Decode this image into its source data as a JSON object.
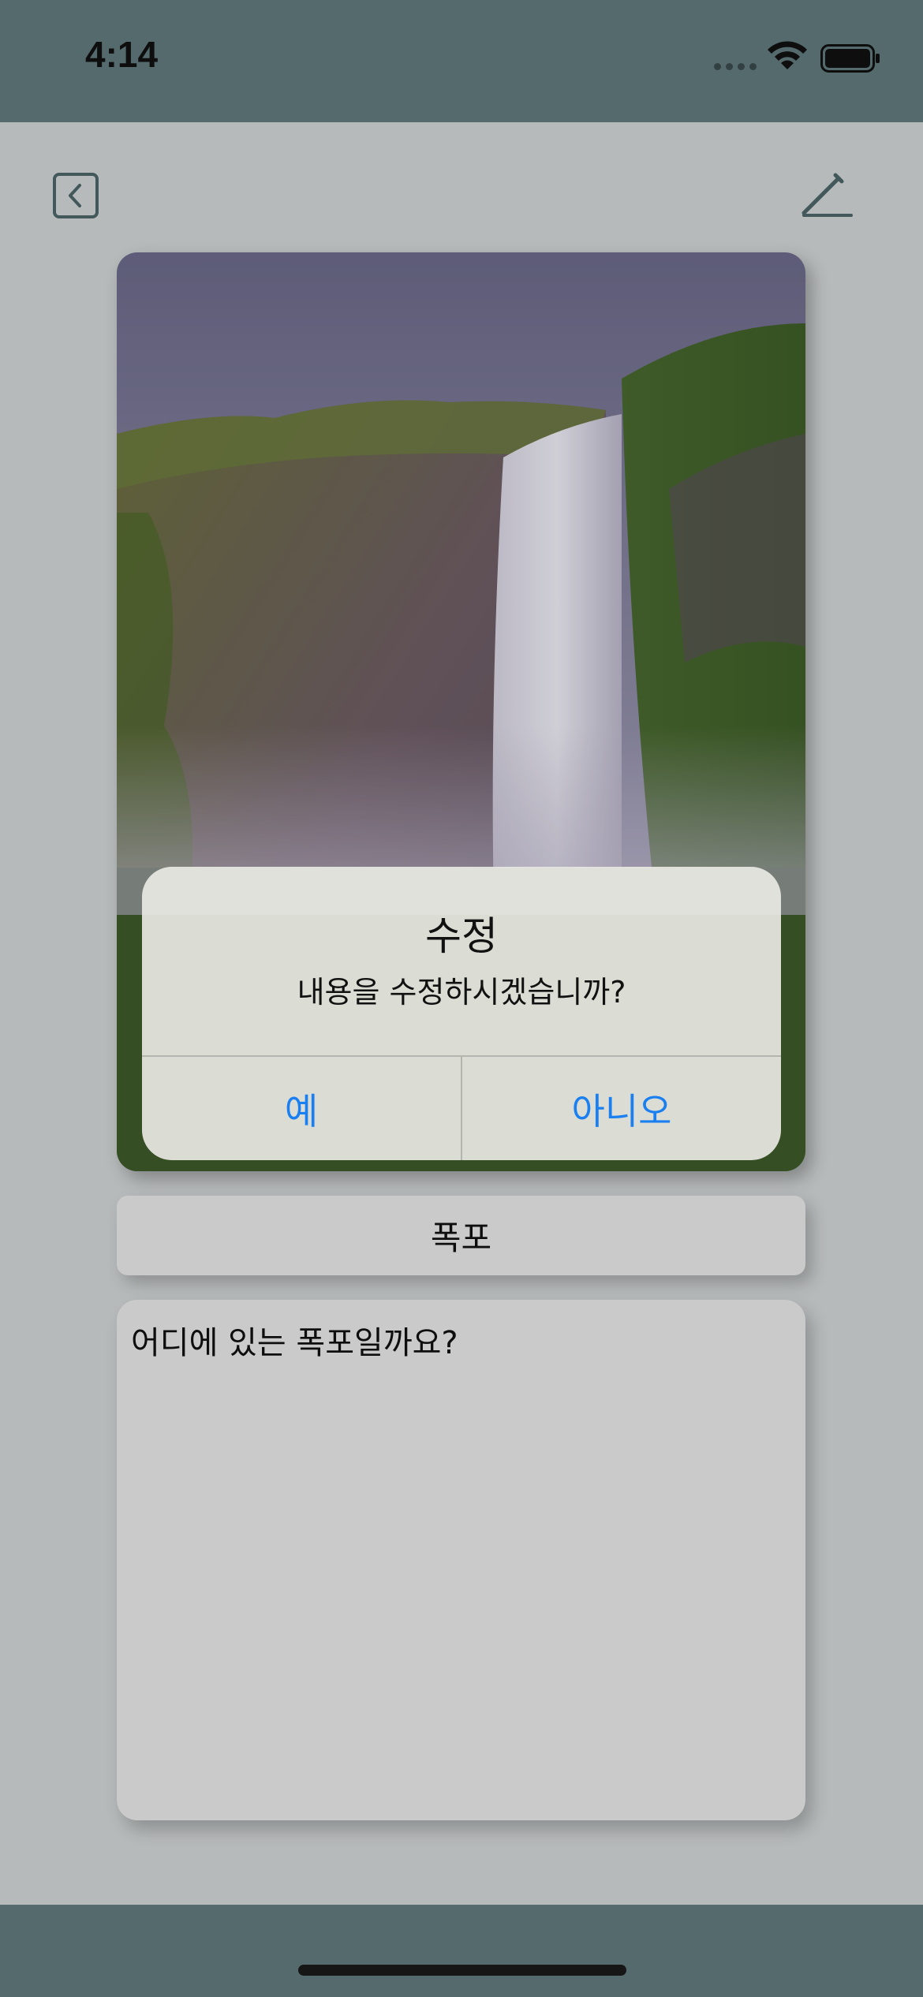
{
  "status_bar": {
    "time": "4:14",
    "icons": [
      "cellular-dots-icon",
      "wifi-icon",
      "battery-icon"
    ]
  },
  "nav": {
    "back_icon": "chevron-left-icon",
    "edit_icon": "pencil-icon"
  },
  "image": {
    "subject": "waterfall photo"
  },
  "memo": {
    "title": "폭포",
    "body": "어디에 있는 폭포일까요?"
  },
  "alert": {
    "title": "수정",
    "message": "내용을 수정하시겠습니까?",
    "confirm_label": "예",
    "cancel_label": "아니오"
  },
  "colors": {
    "bar": "#617a7c",
    "background": "#d2d6d6",
    "accent": "#1a7ff0"
  }
}
